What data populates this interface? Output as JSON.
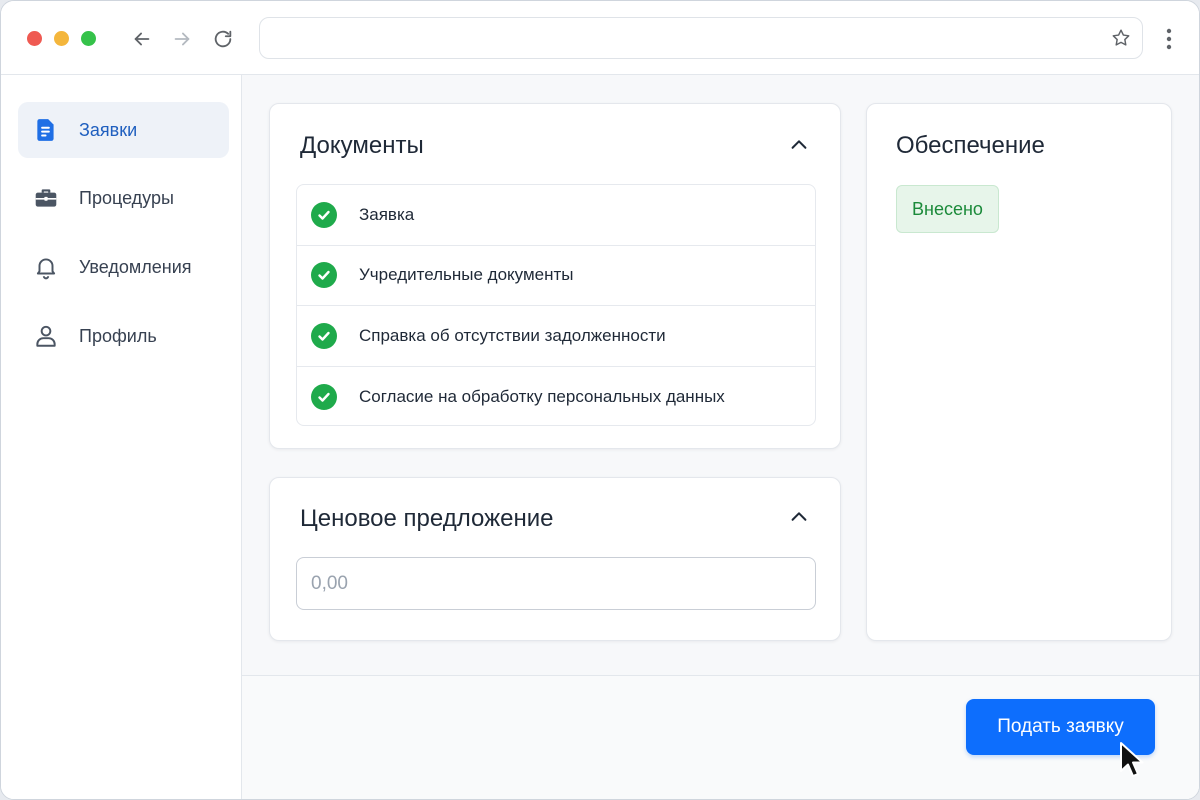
{
  "sidebar": {
    "items": [
      {
        "label": "Заявки",
        "icon": "document-icon",
        "active": true
      },
      {
        "label": "Процедуры",
        "icon": "briefcase-icon",
        "active": false
      },
      {
        "label": "Уведомления",
        "icon": "bell-icon",
        "active": false
      },
      {
        "label": "Профиль",
        "icon": "user-icon",
        "active": false
      }
    ]
  },
  "documents": {
    "title": "Документы",
    "items": [
      {
        "label": "Заявка",
        "status": "done"
      },
      {
        "label": "Учредительные документы",
        "status": "done"
      },
      {
        "label": "Справка об отсутствии задолженности",
        "status": "done"
      },
      {
        "label": "Согласие на обработку персональных данных",
        "status": "done"
      }
    ]
  },
  "price": {
    "title": "Ценовое предложение",
    "placeholder": "0,00",
    "value": ""
  },
  "security": {
    "title": "Обеспечение",
    "status": "Внесено"
  },
  "footer": {
    "submit_label": "Подать заявку"
  },
  "colors": {
    "accent": "#0d6efd",
    "active_nav": "#1f5fbf",
    "success": "#1faa4b",
    "badge_bg": "#e7f5ea",
    "badge_text": "#1b8a3a"
  }
}
